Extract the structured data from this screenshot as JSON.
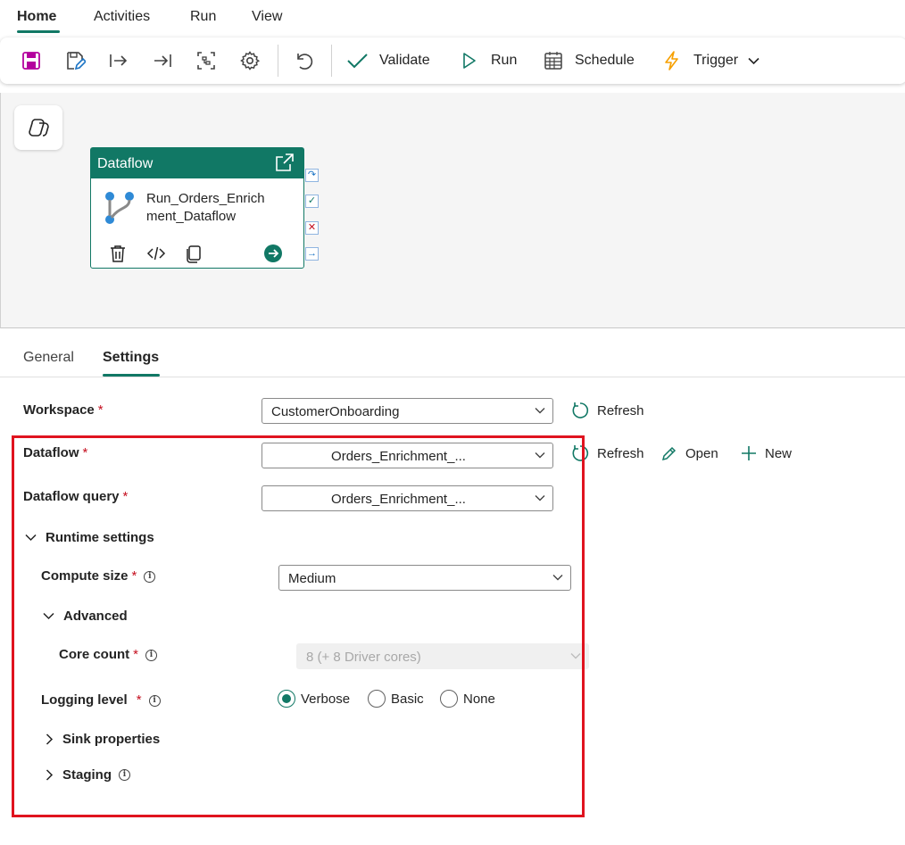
{
  "menu": {
    "items": [
      "Home",
      "Activities",
      "Run",
      "View"
    ]
  },
  "toolbar": {
    "validate_label": "Validate",
    "run_label": "Run",
    "schedule_label": "Schedule",
    "trigger_label": "Trigger"
  },
  "canvas": {
    "activity": {
      "type_label": "Dataflow",
      "name_line1": "Run_Orders_Enrich",
      "name_line2": "ment_Dataflow"
    }
  },
  "tabs": [
    "General",
    "Settings"
  ],
  "form": {
    "workspace": {
      "label": "Workspace",
      "value": "CustomerOnboarding",
      "refresh_label": "Refresh"
    },
    "dataflow": {
      "label": "Dataflow",
      "value": "Orders_Enrichment_...",
      "refresh_label": "Refresh",
      "open_label": "Open",
      "new_label": "New"
    },
    "dataflow_query": {
      "label": "Dataflow query",
      "value": "Orders_Enrichment_..."
    },
    "runtime_settings": {
      "label": "Runtime settings"
    },
    "compute_size": {
      "label": "Compute size",
      "value": "Medium"
    },
    "advanced": {
      "label": "Advanced"
    },
    "core_count": {
      "label": "Core count",
      "value": "8 (+ 8 Driver cores)"
    },
    "logging_level": {
      "label": "Logging level",
      "options": [
        "Verbose",
        "Basic",
        "None"
      ],
      "selected": "Verbose"
    },
    "sink_properties": {
      "label": "Sink properties"
    },
    "staging": {
      "label": "Staging"
    },
    "required_mark": "*",
    "info_mark": "i"
  },
  "colors": {
    "accent": "#117865",
    "required": "#c50f1f",
    "highlight": "#e0131f",
    "save_icon": "#b4009e",
    "trigger_icon": "#f7a000"
  }
}
